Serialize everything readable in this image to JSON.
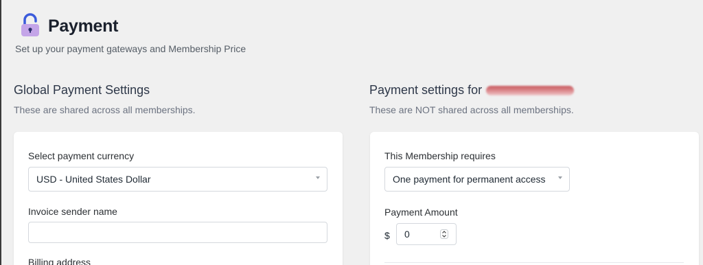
{
  "header": {
    "title": "Payment",
    "subtitle": "Set up your payment gateways and Membership Price"
  },
  "global_settings": {
    "heading": "Global Payment Settings",
    "description": "These are shared across all memberships.",
    "currency_label": "Select payment currency",
    "currency_value": "USD - United States Dollar",
    "invoice_sender_label": "Invoice sender name",
    "invoice_sender_value": "",
    "billing_address_label": "Billing address"
  },
  "membership_settings": {
    "heading": "Payment settings for",
    "description": "These are NOT shared across all memberships.",
    "requires_label": "This Membership requires",
    "requires_value": "One payment for permanent access",
    "amount_label": "Payment Amount",
    "currency_symbol": "$",
    "amount_value": "0"
  },
  "colors": {
    "page_background": "#f0f0f0",
    "card_background": "#ffffff",
    "lock_body": "#c4a5e8",
    "lock_shackle": "#3b5bdb",
    "redaction": "#c85a5f"
  }
}
